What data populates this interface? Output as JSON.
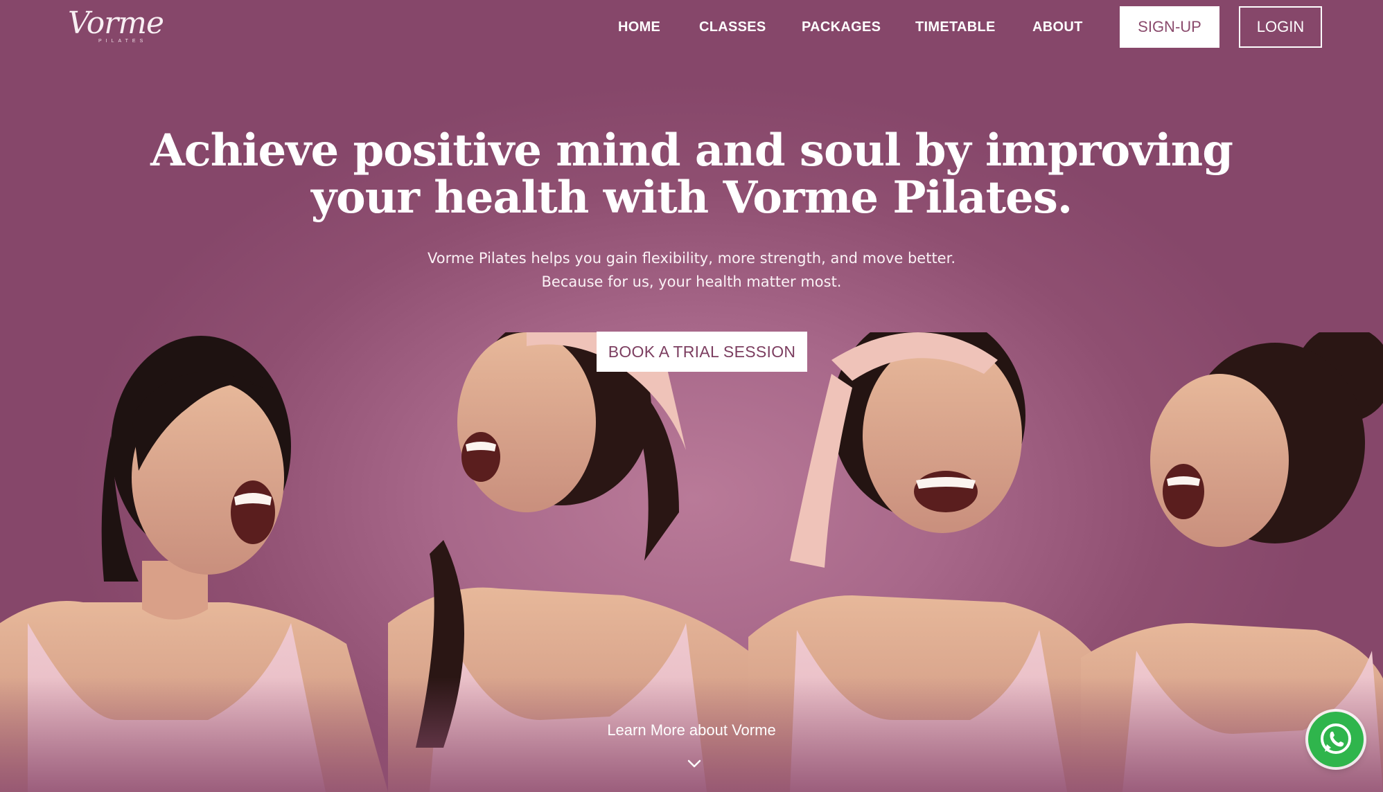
{
  "brand": {
    "logo_text": "Vorme",
    "logo_subtext": "PILATES"
  },
  "nav": {
    "items": [
      {
        "label": "HOME"
      },
      {
        "label": "CLASSES"
      },
      {
        "label": "PACKAGES"
      },
      {
        "label": "TIMETABLE"
      },
      {
        "label": "ABOUT"
      }
    ],
    "signup_label": "SIGN-UP",
    "login_label": "LOGIN"
  },
  "hero": {
    "headline": "Achieve positive mind and soul by improving your health with Vorme Pilates.",
    "subtext_line1": "Vorme Pilates helps you gain flexibility, more strength, and move better.",
    "subtext_line2": "Because for us, your health matter most.",
    "cta_label": "BOOK A TRIAL SESSION",
    "learn_more_label": "Learn More about Vorme"
  },
  "icons": {
    "chevron": "chevron-down-icon",
    "whatsapp": "whatsapp-icon"
  },
  "colors": {
    "background": "#a8688a",
    "accent_text": "#7c3e60",
    "whatsapp_green": "#2fb54c"
  }
}
